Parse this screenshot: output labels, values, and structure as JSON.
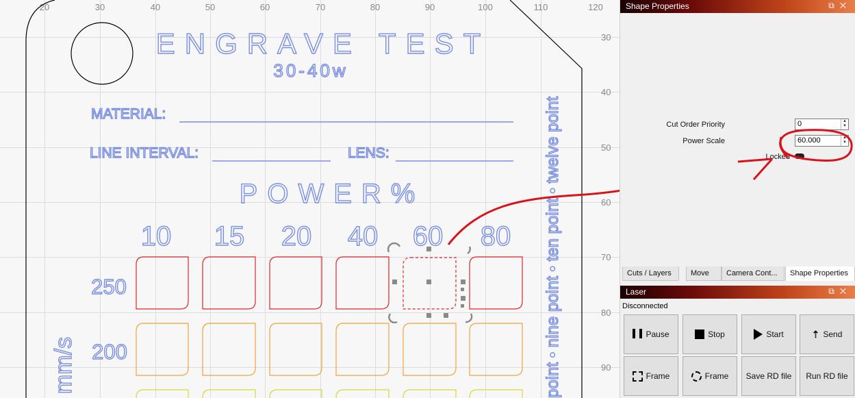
{
  "ruler": {
    "x_labels": [
      "20",
      "30",
      "40",
      "50",
      "60",
      "70",
      "80",
      "90",
      "100",
      "110",
      "120"
    ],
    "y_labels": [
      "30",
      "40",
      "50",
      "60",
      "70",
      "80",
      "90"
    ]
  },
  "design": {
    "title": "ENGRAVE TEST",
    "wattage": "30-40w",
    "material_label": "MATERIAL:",
    "line_interval_label": "LINE INTERVAL:",
    "lens_label": "LENS:",
    "power_label": "POWER%",
    "power_values": [
      "10",
      "15",
      "20",
      "40",
      "60",
      "80"
    ],
    "speed_values": [
      "250",
      "200"
    ],
    "speed_unit": "mm/s",
    "side_text": "point • nine point • ten point • twelve point"
  },
  "shape_properties": {
    "title": "Shape Properties",
    "cut_order_label": "Cut Order Priority",
    "cut_order_value": "0",
    "power_scale_label": "Power Scale",
    "power_scale_value": "60.000",
    "locked_label": "Locked"
  },
  "tabs": [
    {
      "label": "Cuts / Layers"
    },
    {
      "label": "Move"
    },
    {
      "label": "Camera Cont..."
    },
    {
      "label": "Shape Properties"
    }
  ],
  "laser": {
    "title": "Laser",
    "status": "Disconnected",
    "buttons": {
      "pause": "Pause",
      "stop": "Stop",
      "start": "Start",
      "send": "Send",
      "frame1": "Frame",
      "frame2": "Frame",
      "save_rd": "Save RD file",
      "run_rd": "Run RD file"
    }
  },
  "colors": {
    "engrave_blue": "#7b8fe0",
    "row_250": "#e0242a",
    "row_200": "#f2a33a",
    "annotation": "#d8141a"
  }
}
